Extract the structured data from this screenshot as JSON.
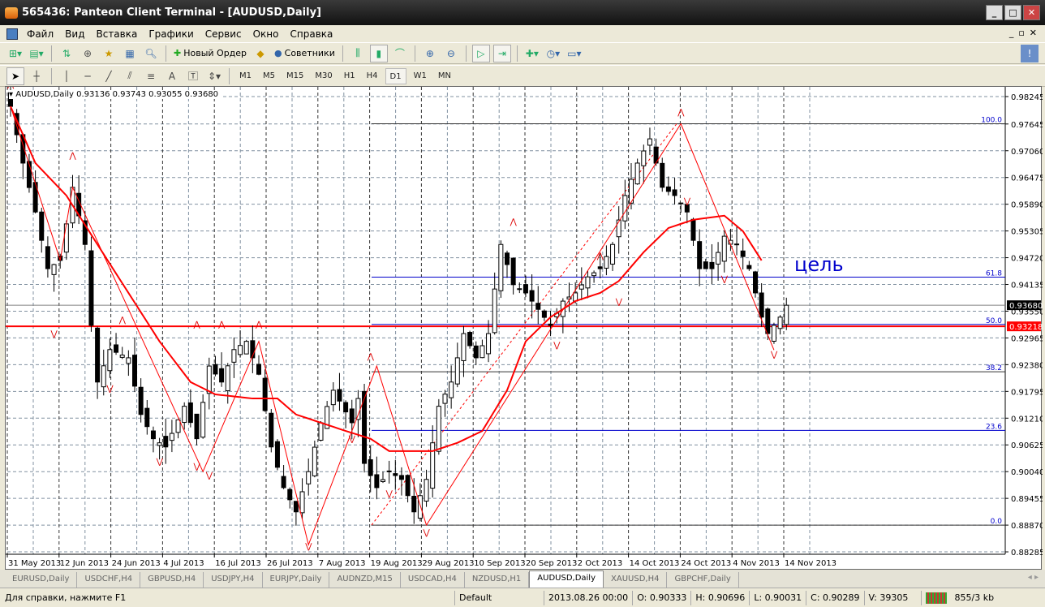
{
  "window": {
    "title": "565436: Panteon Client Terminal - [AUDUSD,Daily]"
  },
  "menu": [
    "Файл",
    "Вид",
    "Вставка",
    "Графики",
    "Сервис",
    "Окно",
    "Справка"
  ],
  "toolbar": {
    "new_order": "Новый Ордер",
    "experts": "Советники"
  },
  "draw_tools": {
    "text_tool": "A"
  },
  "timeframes": [
    "M1",
    "M5",
    "M15",
    "M30",
    "H1",
    "H4",
    "D1",
    "W1",
    "MN"
  ],
  "active_timeframe": "D1",
  "chart": {
    "header": "AUDUSD,Daily  0.93136 0.93743 0.93055 0.93680",
    "annotation": "цель"
  },
  "chart_data": {
    "type": "candlestick",
    "symbol": "AUDUSD",
    "period": "Daily",
    "ylim": [
      0.88,
      0.9847
    ],
    "price_ticks": [
      "0.98245",
      "0.97645",
      "0.97060",
      "0.96475",
      "0.95890",
      "0.95305",
      "0.94720",
      "0.94135",
      "0.93550",
      "0.92965",
      "0.92380",
      "0.91795",
      "0.91210",
      "0.90625",
      "0.90040",
      "0.89455",
      "0.88870",
      "0.88285"
    ],
    "date_ticks": [
      "31 May 2013",
      "12 Jun 2013",
      "24 Jun 2013",
      "4 Jul 2013",
      "16 Jul 2013",
      "26 Jul 2013",
      "7 Aug 2013",
      "19 Aug 2013",
      "29 Aug 2013",
      "10 Sep 2013",
      "20 Sep 2013",
      "2 Oct 2013",
      "14 Oct 2013",
      "24 Oct 2013",
      "4 Nov 2013",
      "14 Nov 2013"
    ],
    "close_keypoints": [
      [
        0,
        0.9803
      ],
      [
        2,
        0.9679
      ],
      [
        4,
        0.9572
      ],
      [
        6,
        0.9448
      ],
      [
        8,
        0.9466
      ],
      [
        10,
        0.9626
      ],
      [
        12,
        0.9501
      ],
      [
        13,
        0.9324
      ],
      [
        14,
        0.92
      ],
      [
        16,
        0.9271
      ],
      [
        19,
        0.9253
      ],
      [
        21,
        0.9129
      ],
      [
        23,
        0.9076
      ],
      [
        25,
        0.9058
      ],
      [
        28,
        0.9147
      ],
      [
        30,
        0.9076
      ],
      [
        32,
        0.9235
      ],
      [
        34,
        0.92
      ],
      [
        36,
        0.9271
      ],
      [
        38,
        0.9289
      ],
      [
        40,
        0.9217
      ],
      [
        42,
        0.9058
      ],
      [
        44,
        0.8969
      ],
      [
        46,
        0.8916
      ],
      [
        48,
        0.9004
      ],
      [
        50,
        0.9111
      ],
      [
        52,
        0.9182
      ],
      [
        55,
        0.9111
      ],
      [
        56,
        0.9164
      ],
      [
        57,
        0.9022
      ],
      [
        59,
        0.8969
      ],
      [
        61,
        0.9004
      ],
      [
        63,
        0.8987
      ],
      [
        65,
        0.8916
      ],
      [
        67,
        0.8987
      ],
      [
        69,
        0.9147
      ],
      [
        71,
        0.92
      ],
      [
        73,
        0.9306
      ],
      [
        75,
        0.9253
      ],
      [
        77,
        0.9306
      ],
      [
        79,
        0.9501
      ],
      [
        81,
        0.9413
      ],
      [
        83,
        0.9395
      ],
      [
        85,
        0.9359
      ],
      [
        87,
        0.9324
      ],
      [
        89,
        0.9377
      ],
      [
        91,
        0.9395
      ],
      [
        93,
        0.943
      ],
      [
        95,
        0.9448
      ],
      [
        97,
        0.9501
      ],
      [
        99,
        0.9608
      ],
      [
        101,
        0.9679
      ],
      [
        103,
        0.9732
      ],
      [
        105,
        0.9626
      ],
      [
        107,
        0.9608
      ],
      [
        109,
        0.9572
      ],
      [
        111,
        0.9448
      ],
      [
        113,
        0.9448
      ],
      [
        115,
        0.9519
      ],
      [
        117,
        0.9501
      ],
      [
        119,
        0.9448
      ],
      [
        121,
        0.9342
      ],
      [
        122,
        0.9306
      ],
      [
        124,
        0.9342
      ],
      [
        125,
        0.9368
      ]
    ],
    "ma_keypoints": [
      [
        0,
        0.9803
      ],
      [
        4,
        0.9679
      ],
      [
        9,
        0.9608
      ],
      [
        14,
        0.9501
      ],
      [
        19,
        0.9395
      ],
      [
        24,
        0.9289
      ],
      [
        29,
        0.92
      ],
      [
        33,
        0.9173
      ],
      [
        39,
        0.9164
      ],
      [
        43,
        0.9164
      ],
      [
        46,
        0.9129
      ],
      [
        50,
        0.9111
      ],
      [
        54,
        0.9093
      ],
      [
        58,
        0.9076
      ],
      [
        61,
        0.9049
      ],
      [
        65,
        0.9049
      ],
      [
        68,
        0.9049
      ],
      [
        72,
        0.9067
      ],
      [
        76,
        0.9093
      ],
      [
        80,
        0.9182
      ],
      [
        83,
        0.9289
      ],
      [
        87,
        0.9342
      ],
      [
        91,
        0.9377
      ],
      [
        95,
        0.9395
      ],
      [
        98,
        0.9421
      ],
      [
        102,
        0.9484
      ],
      [
        106,
        0.9537
      ],
      [
        110,
        0.9555
      ],
      [
        115,
        0.9564
      ],
      [
        118,
        0.953
      ],
      [
        121,
        0.9466
      ]
    ],
    "horizontal_lines": [
      {
        "price": "0.93680",
        "color": "#808080"
      },
      {
        "price": "0.93218",
        "color": "#ff0000"
      }
    ],
    "fibonacci": {
      "levels": [
        "100.0",
        "61.8",
        "50.0",
        "38.2",
        "23.6",
        "0.0"
      ],
      "low": 0.8887,
      "high": 0.9765
    },
    "colors": {
      "bull": "#ffffff",
      "bear": "#000000",
      "ma": "#ff0000",
      "fib": "#0000cc"
    }
  },
  "tabs": [
    "EURUSD,Daily",
    "USDCHF,H4",
    "GBPUSD,H4",
    "USDJPY,H4",
    "EURJPY,Daily",
    "AUDNZD,M15",
    "USDCAD,H4",
    "NZDUSD,H1",
    "AUDUSD,Daily",
    "XAUUSD,H4",
    "GBPCHF,Daily"
  ],
  "active_tab": "AUDUSD,Daily",
  "status": {
    "help": "Для справки, нажмите F1",
    "profile": "Default",
    "time": "2013.08.26 00:00",
    "open": "O: 0.90333",
    "high": "H: 0.90696",
    "low": "L: 0.90031",
    "close": "C: 0.90289",
    "volume": "V: 39305",
    "traffic": "855/3 kb"
  }
}
